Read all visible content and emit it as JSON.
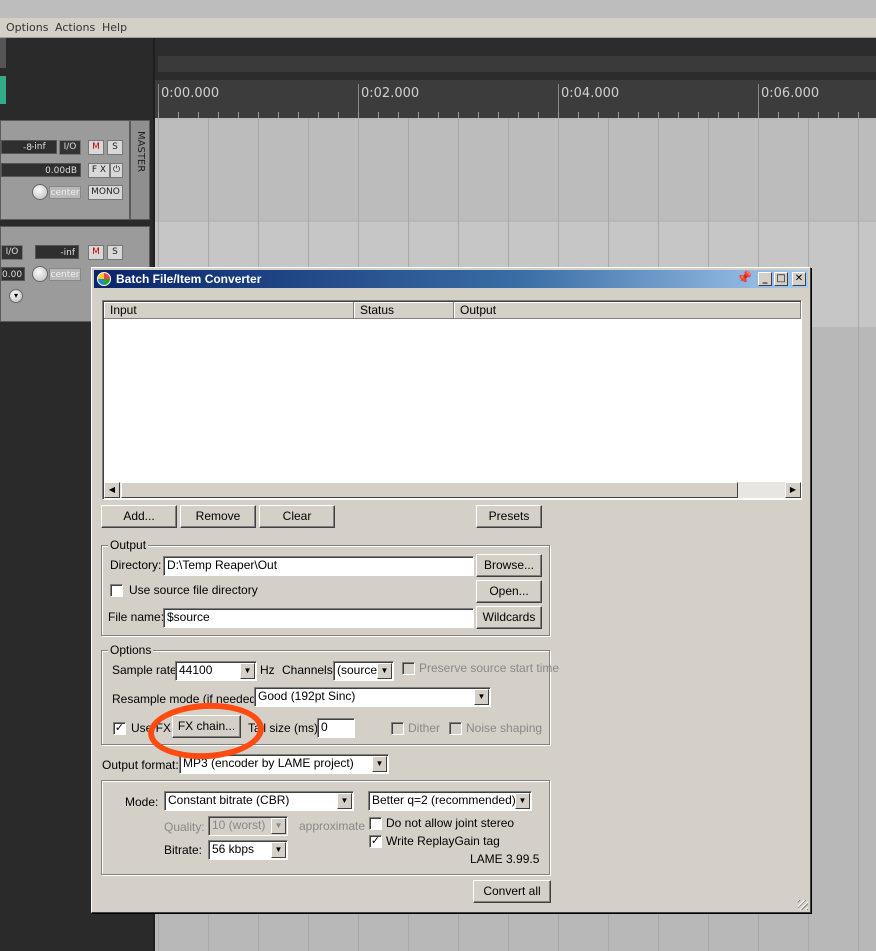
{
  "menubar": {
    "items": [
      "Options",
      "Actions",
      "Help"
    ]
  },
  "ruler": {
    "ticks": [
      "0:00.000",
      "0:02.000",
      "0:04.000",
      "0:06.000"
    ]
  },
  "master_track": {
    "label": "MASTER",
    "peak_left": "-8",
    "peak_right": "-inf",
    "io": "I/O",
    "mute": "M",
    "solo": "S",
    "volume": "0.00dB",
    "fx": "F X",
    "pan": "center",
    "mono": "MONO"
  },
  "track2": {
    "meter": "-inf",
    "io": "I/O",
    "mute": "M",
    "solo": "S",
    "volume": "0.00",
    "pan": "center"
  },
  "dialog": {
    "title": "Batch File/Item Converter",
    "list_columns": [
      "Input",
      "Status",
      "Output"
    ],
    "buttons": {
      "add": "Add...",
      "remove": "Remove",
      "clear": "Clear",
      "presets": "Presets"
    },
    "output": {
      "group_title": "Output",
      "directory_label": "Directory:",
      "directory_value": "D:\\Temp Reaper\\Out",
      "browse": "Browse...",
      "use_source_dir": "Use source file directory",
      "open": "Open...",
      "filename_label": "File name:",
      "filename_value": "$source",
      "wildcards": "Wildcards"
    },
    "options": {
      "group_title": "Options",
      "sample_rate_label": "Sample rate:",
      "sample_rate_value": "44100",
      "hz": "Hz",
      "channels_label": "Channels:",
      "channels_value": "(source)",
      "preserve_start": "Preserve source start time",
      "resample_label": "Resample mode (if needed):",
      "resample_value": "Good (192pt Sinc)",
      "use_fx_label": "Use FX",
      "use_fx_checked": true,
      "fx_chain": "FX chain...",
      "tail_label": "Tail size (ms):",
      "tail_value": "0",
      "dither": "Dither",
      "noise_shaping": "Noise shaping"
    },
    "format": {
      "label": "Output format:",
      "value": "MP3 (encoder by LAME project)"
    },
    "mp3": {
      "mode_label": "Mode:",
      "mode_value": "Constant bitrate  (CBR)",
      "quality_select": "Better q=2 (recommended)",
      "quality_label": "Quality:",
      "quality_value": "10 (worst)",
      "approximate": "approximate",
      "joint_stereo": "Do not allow joint stereo",
      "joint_stereo_checked": false,
      "replaygain": "Write ReplayGain tag",
      "replaygain_checked": true,
      "bitrate_label": "Bitrate:",
      "bitrate_value": "56 kbps",
      "lame_version": "LAME 3.99.5"
    },
    "convert_all": "Convert all"
  },
  "colors": {
    "annotation_circle": "#ff4a10",
    "title_gradient_start": "#0a246a"
  }
}
